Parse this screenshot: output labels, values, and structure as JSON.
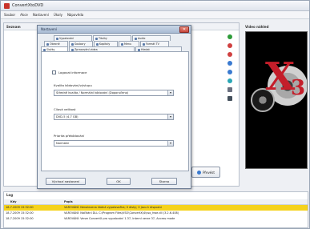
{
  "window": {
    "title": "ConvertXtoDVD"
  },
  "menu": {
    "items": [
      "Soubor",
      "Akce",
      "Nastavení",
      "Úkoly",
      "Nápověda"
    ]
  },
  "seznam": {
    "label": "Seznam"
  },
  "preview": {
    "label": "Video náhled"
  },
  "prevest_button": {
    "label": "Převést"
  },
  "dialog": {
    "title": "Nastavení",
    "close": "✕",
    "tabs_row1": [
      "Vypalování",
      "Titulky",
      "Audio"
    ],
    "tabs_row2": [
      "Obecné",
      "Soubory",
      "Kapitoly",
      "Menu",
      "Formát TV"
    ],
    "tabs_row3": [
      "Složky",
      "Zpracování videa",
      "Hledat"
    ],
    "checkbox_label": "Logovat informace",
    "fields": [
      {
        "label": "Kvalita kódování/výstupu",
        "value": "Středně kvalita / Normální kódování (Doporučeno)"
      },
      {
        "label": "Cílová velikost",
        "value": "DVD-5 (4,7 GB)"
      },
      {
        "label": "Priorita překódování",
        "value": "Normální"
      }
    ],
    "buttons": {
      "reset": "Výchozí nastavení",
      "ok": "OK",
      "cancel": "Storno"
    }
  },
  "log": {
    "title": "Log",
    "columns": [
      "Kdy",
      "Popis"
    ],
    "rows": [
      {
        "time": "18.7.2009 15:32:00",
        "desc": "VAROVÁNÍ: Nenalezena žádná vypalovačka; 0 disky; 0 jsou k dispozici",
        "highlight": true
      },
      {
        "time": "18.7.2009 15:32:00",
        "desc": "VAROVÁNÍ: Načítání DLL C:\\Program Files\\VSO\\ConvertX\\4\\vso_hwe.dll (3.2.6.408)",
        "highlight": false
      },
      {
        "time": "18.7.2009 15:32:00",
        "desc": "VAROVÁNÍ: Verze ConvertX pro vypalování 1.37, Interní verze 37, Access mode",
        "highlight": false
      }
    ]
  }
}
